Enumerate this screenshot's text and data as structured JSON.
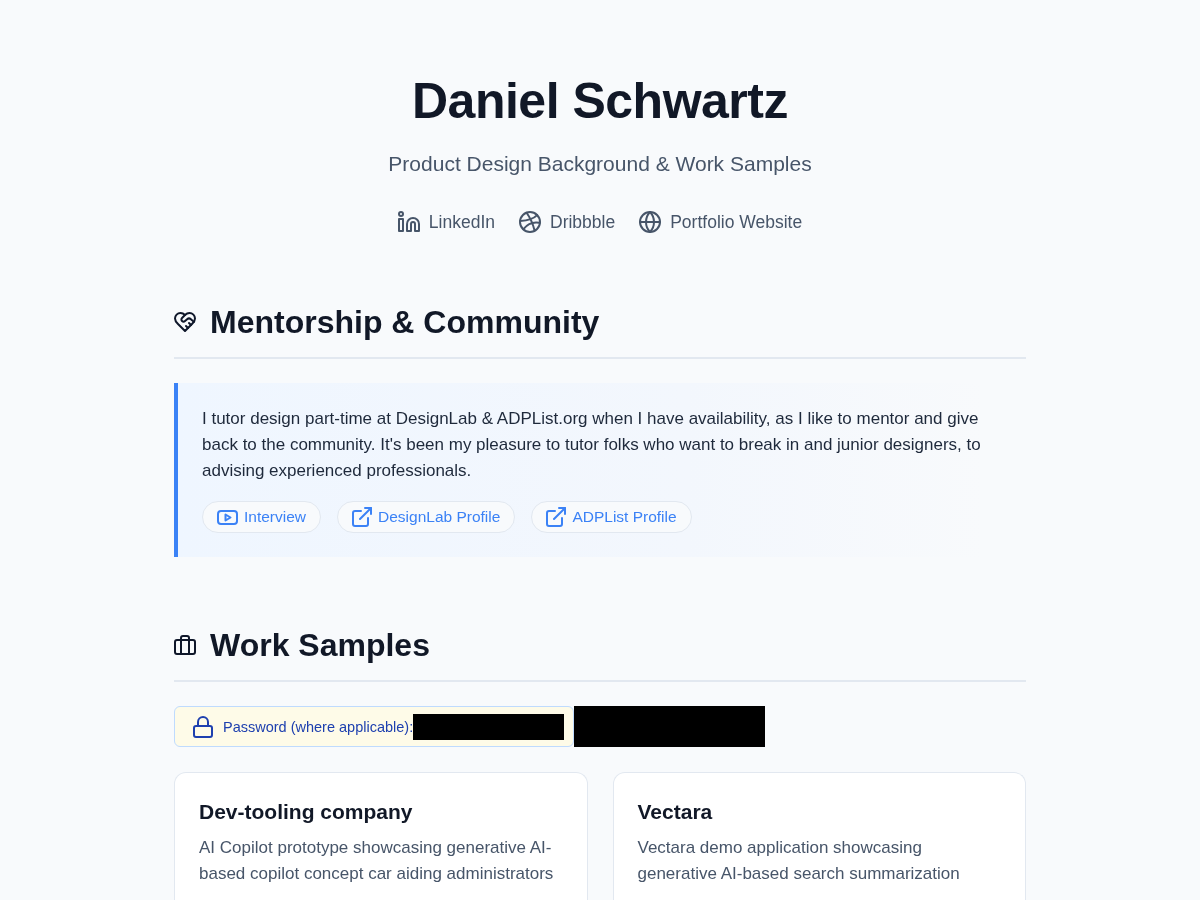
{
  "header": {
    "name": "Daniel Schwartz",
    "tagline": "Product Design Background & Work Samples",
    "links": [
      {
        "kind": "linkedin",
        "label": "LinkedIn"
      },
      {
        "kind": "dribbble",
        "label": "Dribbble"
      },
      {
        "kind": "globe",
        "label": "Portfolio Website"
      }
    ]
  },
  "mentorship": {
    "title": "Mentorship & Community",
    "text": "I tutor design part-time at DesignLab & ADPList.org when I have availability, as I like to mentor and give back to the community. It's been my pleasure to tutor folks who want to break in and junior designers, to advising experienced professionals.",
    "links": [
      {
        "kind": "video",
        "label": "Interview"
      },
      {
        "kind": "external",
        "label": "DesignLab Profile"
      },
      {
        "kind": "external",
        "label": "ADPList Profile"
      }
    ]
  },
  "work_samples": {
    "title": "Work Samples",
    "password_notice": {
      "label": "Password (where applicable):",
      "redacted": true
    },
    "cards": [
      {
        "title": "Dev-tooling company",
        "description": "AI Copilot prototype showcasing generative AI-based copilot concept car aiding administrators"
      },
      {
        "title": "Vectara",
        "description": "Vectara demo application showcasing generative AI-based search summarization"
      }
    ]
  }
}
